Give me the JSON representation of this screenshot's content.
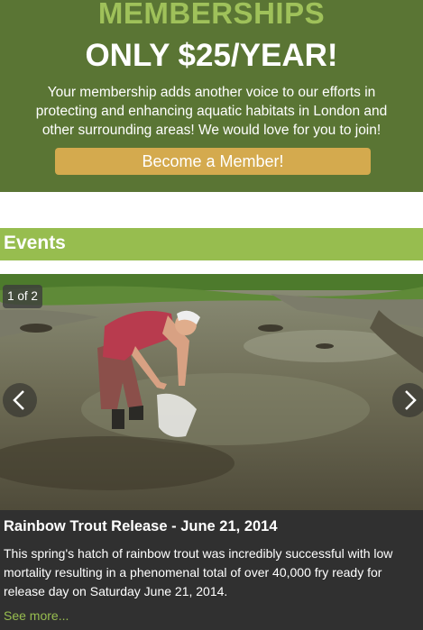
{
  "membership": {
    "heading": "MEMBERSHIPS",
    "price": "ONLY $25/YEAR!",
    "description": "Your membership adds another voice to our efforts in protecting and enhancing aquatic habitats in London and other surrounding areas! We would love for you to join!",
    "cta_label": "Become a Member!"
  },
  "events": {
    "section_title": "Events",
    "slider": {
      "counter": "1 of 2",
      "prev_icon": "chevron-left-icon",
      "next_icon": "chevron-right-icon"
    },
    "current": {
      "title": "Rainbow Trout Release - June 21, 2014",
      "description": "This spring's hatch of rainbow trout was incredibly successful with low mortality resulting in a phenomenal total of over 40,000 fry ready for release day on Saturday June 21, 2014.",
      "link_label": "See more..."
    }
  },
  "colors": {
    "hero_bg": "#5a7534",
    "heading_green": "#9fc15a",
    "cta_gold": "#d4aa4e",
    "section_bar": "#97bd4f",
    "caption_bg": "#303030",
    "link_green": "#97bd4f"
  }
}
